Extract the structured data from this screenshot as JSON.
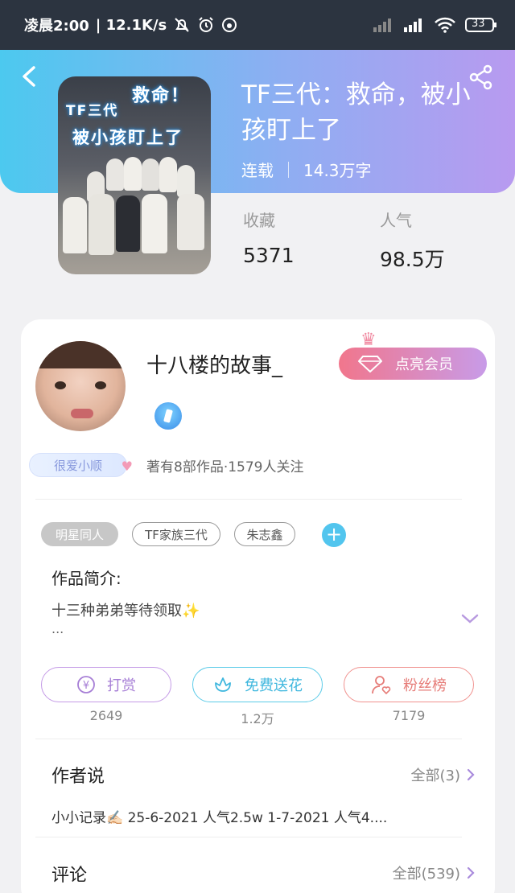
{
  "status_bar": {
    "time": "凌晨2:00",
    "speed": "| 12.1K/s",
    "battery": "33"
  },
  "book": {
    "title": "TF三代：救命，被小孩盯上了",
    "status": "连载",
    "word_count": "14.3万字",
    "favorites_label": "收藏",
    "favorites_value": "5371",
    "popularity_label": "人气",
    "popularity_value": "98.5万",
    "cover_caption_1": "救命！",
    "cover_caption_2": "TF三代",
    "cover_caption_3": "被小孩盯上了"
  },
  "author": {
    "name": "十八楼的故事_",
    "badge": "很爱小顺",
    "info": "著有8部作品·1579人关注",
    "vip_button": "点亮会员"
  },
  "tags": [
    "明星同人",
    "TF家族三代",
    "朱志鑫"
  ],
  "intro": {
    "title": "作品简介:",
    "text": "十三种弟弟等待领取✨",
    "ellipsis": "..."
  },
  "actions": {
    "reward_label": "打赏",
    "reward_count": "2649",
    "flower_label": "免费送花",
    "flower_count": "1.2万",
    "fans_label": "粉丝榜",
    "fans_count": "7179"
  },
  "author_says": {
    "title": "作者说",
    "more": "全部(3)",
    "content": "小小记录✍🏻 25-6-2021 人气2.5w  1-7-2021 人气4...."
  },
  "comments": {
    "title": "评论",
    "more": "全部(539)"
  },
  "colors": {
    "header_gradient_start": "#4cc9ef",
    "header_gradient_end": "#b89af0",
    "vip_gradient_start": "#f1768c",
    "vip_gradient_end": "#c89be8"
  }
}
